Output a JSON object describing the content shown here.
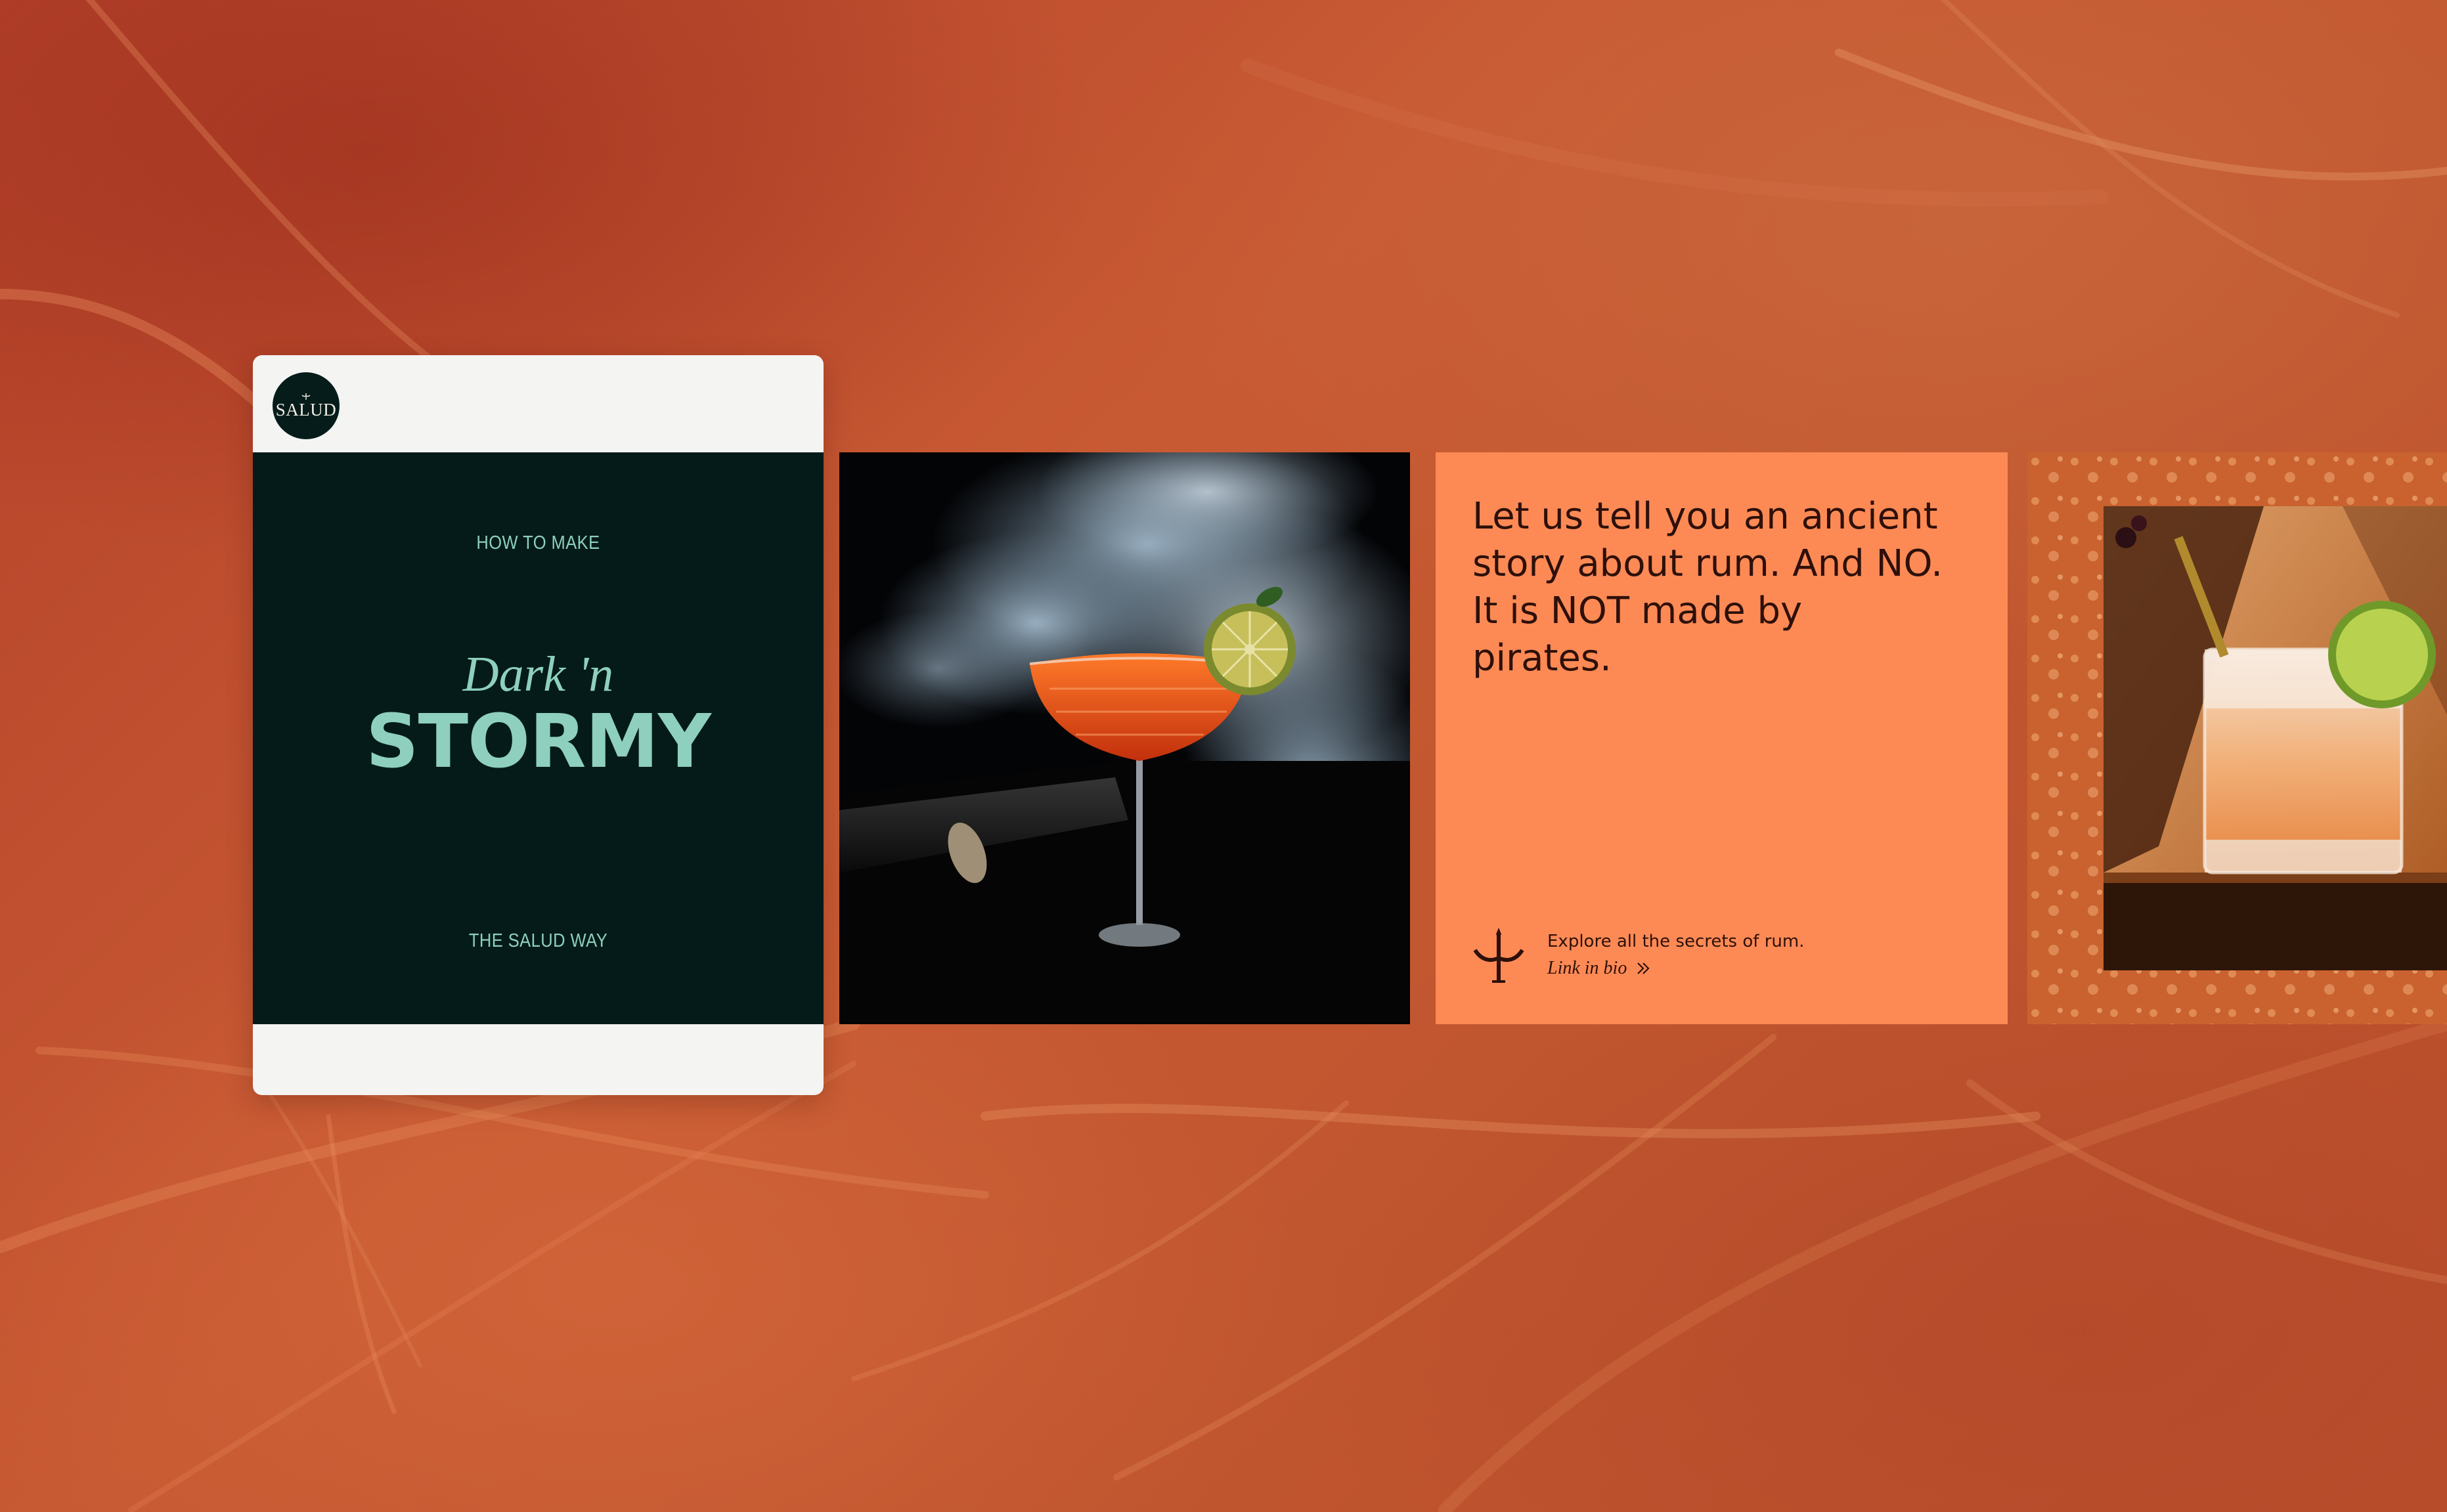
{
  "post": {
    "avatar_text": "SALUD",
    "slide": {
      "kicker": "HOW TO MAKE",
      "script_title": "Dark 'n",
      "title": "STORMY",
      "footer": "THE SALUD WAY"
    }
  },
  "story_slide": {
    "text": "Let us tell you an ancient story about rum. And NO. It is NOT made by pirates.",
    "cta_line": "Explore all the secrets of rum.",
    "link_label": "Link in bio",
    "icon": "salud-plant-icon"
  },
  "slides": [
    {
      "type": "photo",
      "icon": "smoky-cocktail-photo"
    },
    {
      "type": "text"
    },
    {
      "type": "photo",
      "icon": "highball-cocktail-photo"
    }
  ],
  "colors": {
    "background": "#c4552f",
    "post_card": "#f4f4f2",
    "slide_dark": "#051b19",
    "slide_accent": "#8ed0bd",
    "story_bg": "#fd8a55",
    "story_text": "#2e100a"
  }
}
